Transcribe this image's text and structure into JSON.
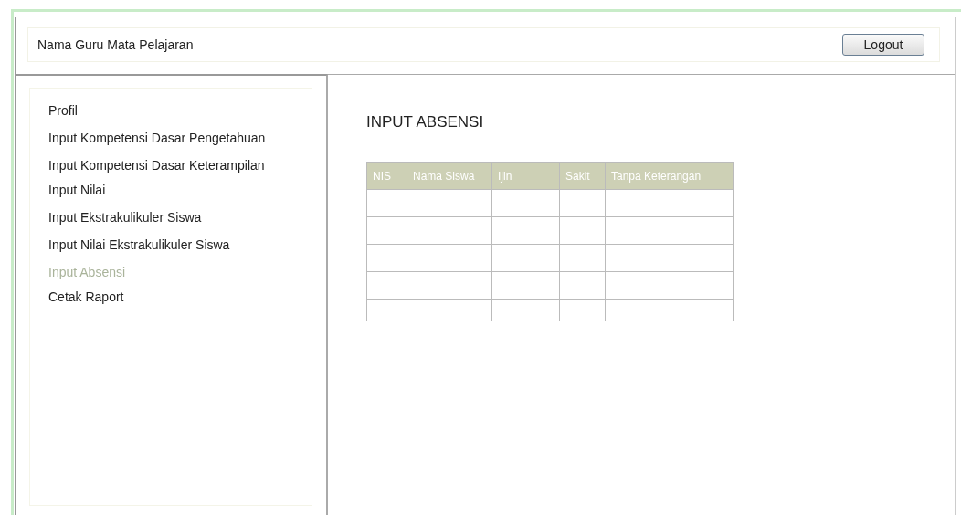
{
  "header": {
    "title": "Nama Guru Mata Pelajaran",
    "logout_button": "Logout"
  },
  "sidebar": {
    "groups": [
      [
        {
          "label": "Profil",
          "selected": false
        },
        {
          "label": "Input Kompetensi Dasar Pengetahuan",
          "selected": false
        },
        {
          "label": "Input Kompetensi Dasar Keterampilan",
          "selected": false
        }
      ],
      [
        {
          "label": "Input Nilai",
          "selected": false
        },
        {
          "label": "Input Ekstrakulikuler Siswa",
          "selected": false
        },
        {
          "label": "Input Nilai Ekstrakulikuler Siswa",
          "selected": false
        },
        {
          "label": "Input Absensi",
          "selected": true
        }
      ],
      [
        {
          "label": "Cetak Raport",
          "selected": false
        }
      ]
    ]
  },
  "content": {
    "title": "INPUT ABSENSI",
    "table": {
      "columns": [
        "NIS",
        "Nama Siswa",
        "Ijin",
        "Sakit",
        "Tanpa Keterangan"
      ]
    }
  }
}
